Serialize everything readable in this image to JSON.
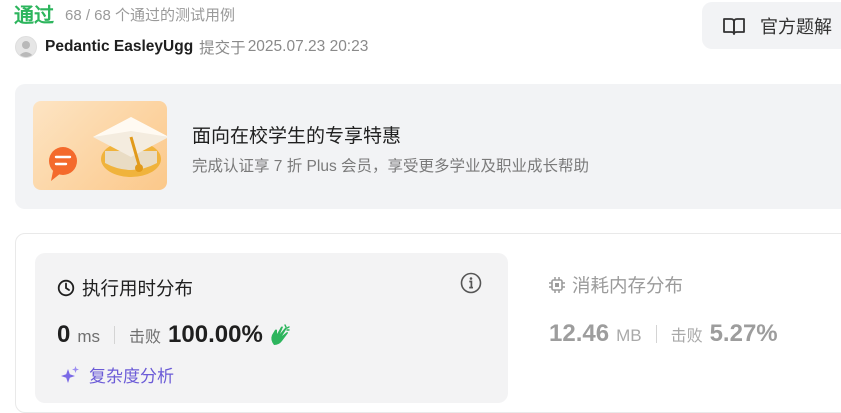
{
  "header": {
    "status": "通过",
    "testcases": "68 / 68 个通过的测试用例"
  },
  "author": {
    "username": "Pedantic EasleyUgg",
    "submit_label": "提交于",
    "submit_time": "2025.07.23 20:23"
  },
  "solution_button": {
    "label": "官方题解"
  },
  "promo": {
    "title": "面向在校学生的专享特惠",
    "subtitle": "完成认证享 7 折 Plus 会员，享受更多学业及职业成长帮助"
  },
  "runtime": {
    "title": "执行用时分布",
    "value": "0",
    "unit": "ms",
    "beat_label": "击败",
    "beat_percent": "100.00%",
    "complexity_label": "复杂度分析"
  },
  "memory": {
    "title": "消耗内存分布",
    "value": "12.46",
    "unit": "MB",
    "beat_label": "击败",
    "beat_percent": "5.27%"
  },
  "colors": {
    "passed": "#2db55d",
    "complexity": "#6b5bd7",
    "promo_gold": "#f0b33c",
    "promo_orange": "#f46a2c"
  },
  "icons": {
    "solution": "book-open-icon",
    "runtime": "clock-icon",
    "info": "info-icon",
    "memory": "chip-icon",
    "complexity": "sparkle-icon",
    "beat": "clap-icon"
  }
}
